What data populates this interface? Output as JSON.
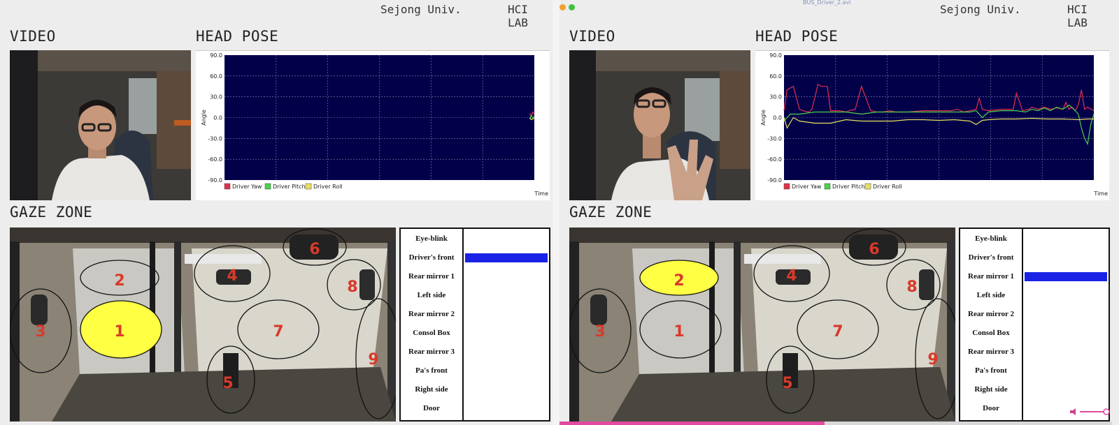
{
  "header": {
    "university": "Sejong Univ.",
    "lab": "HCI LAB"
  },
  "sections": {
    "video": "VIDEO",
    "head_pose": "HEAD POSE",
    "gaze_zone": "GAZE ZONE"
  },
  "player": {
    "file_name": "BUS_Driver_2.avi",
    "progress": 0.48
  },
  "colors": {
    "yaw": "#e0304a",
    "pitch": "#4ad24a",
    "roll": "#e8e060",
    "plot_bg": "#03004a",
    "highlight": "#ffff44",
    "bar": "#1a22e6"
  },
  "zone_labels": [
    "Eye-blink",
    "Driver's front",
    "Rear mirror 1",
    "Left side",
    "Rear mirror 2",
    "Consol Box",
    "Rear mirror 3",
    "Pa's front",
    "Right side",
    "Door"
  ],
  "zone_numbers": [
    "1",
    "2",
    "3",
    "4",
    "5",
    "6",
    "7",
    "8",
    "9"
  ],
  "panels": [
    {
      "active_zone_label": "Driver's front",
      "active_zone_number": "1"
    },
    {
      "active_zone_label": "Rear mirror 1",
      "active_zone_number": "2"
    }
  ],
  "chart_data": [
    {
      "type": "line",
      "ylabel": "Angle",
      "xlabel": "Time",
      "ylim": [
        -90,
        90
      ],
      "yticks": [
        "90.0",
        "60.0",
        "30.0",
        "0.0",
        "-30.0",
        "-60.0",
        "-90.0"
      ],
      "grid": true,
      "legend": "bottom-left",
      "x_domain": [
        0,
        100
      ],
      "series": [
        {
          "name": "Driver Yaw",
          "x": [
            98.5,
            99,
            99.5,
            100
          ],
          "y": [
            6,
            2,
            8,
            4
          ]
        },
        {
          "name": "Driver Pitch",
          "x": [
            98.5,
            99,
            99.5,
            100
          ],
          "y": [
            -2,
            3,
            -1,
            2
          ]
        },
        {
          "name": "Driver Roll",
          "x": [
            98.5,
            99,
            99.5,
            100
          ],
          "y": [
            0,
            -3,
            -2,
            -1
          ]
        }
      ]
    },
    {
      "type": "line",
      "ylabel": "Angle",
      "xlabel": "Time",
      "ylim": [
        -90,
        90
      ],
      "yticks": [
        "90.0",
        "60.0",
        "30.0",
        "0.0",
        "-30.0",
        "-60.0",
        "-90.0"
      ],
      "grid": true,
      "legend": "bottom-left",
      "x_domain": [
        0,
        100
      ],
      "series": [
        {
          "name": "Driver Yaw",
          "x": [
            0,
            1,
            3,
            5,
            6,
            8,
            9,
            11,
            12,
            14,
            15,
            16,
            18,
            20,
            21,
            23,
            25,
            28,
            30,
            32,
            34,
            36,
            38,
            40,
            45,
            50,
            52,
            54,
            56,
            58,
            60,
            62,
            63,
            64,
            66,
            70,
            72,
            74,
            75,
            77,
            79,
            80,
            82,
            84,
            86,
            88,
            90,
            91,
            92,
            93,
            94,
            95,
            96,
            97,
            98,
            100
          ],
          "y": [
            10,
            40,
            45,
            12,
            10,
            8,
            12,
            48,
            45,
            45,
            10,
            10,
            10,
            8,
            10,
            12,
            45,
            10,
            8,
            8,
            10,
            8,
            8,
            8,
            10,
            10,
            10,
            10,
            12,
            8,
            10,
            12,
            28,
            12,
            10,
            12,
            12,
            12,
            35,
            10,
            12,
            15,
            12,
            15,
            12,
            14,
            12,
            22,
            12,
            15,
            10,
            18,
            40,
            12,
            15,
            10
          ]
        },
        {
          "name": "Driver Pitch",
          "x": [
            0,
            2,
            5,
            10,
            15,
            20,
            25,
            30,
            35,
            40,
            45,
            50,
            55,
            60,
            62,
            64,
            66,
            70,
            75,
            78,
            80,
            82,
            84,
            86,
            88,
            90,
            92,
            94,
            95,
            96,
            97,
            98,
            99,
            100
          ],
          "y": [
            -5,
            5,
            5,
            8,
            8,
            8,
            5,
            8,
            8,
            8,
            8,
            8,
            8,
            8,
            10,
            0,
            8,
            10,
            10,
            8,
            12,
            10,
            14,
            10,
            15,
            12,
            18,
            10,
            5,
            -15,
            -30,
            -38,
            -10,
            5
          ]
        },
        {
          "name": "Driver Roll",
          "x": [
            0,
            1,
            3,
            5,
            10,
            15,
            20,
            25,
            30,
            35,
            40,
            45,
            50,
            55,
            60,
            62,
            64,
            66,
            70,
            75,
            80,
            85,
            90,
            95,
            98,
            100
          ],
          "y": [
            0,
            -15,
            0,
            -5,
            -8,
            -8,
            -3,
            -5,
            -5,
            -5,
            -3,
            -3,
            -4,
            -3,
            -5,
            -10,
            -4,
            -3,
            -2,
            -2,
            -1,
            -2,
            -2,
            -3,
            -2,
            -2
          ]
        }
      ]
    }
  ]
}
